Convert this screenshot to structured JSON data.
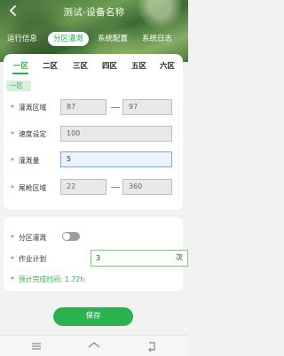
{
  "header": {
    "title": "测试-设备名称"
  },
  "tabs": [
    {
      "label": "运行信息"
    },
    {
      "label": "分区灌溉"
    },
    {
      "label": "系统配置"
    },
    {
      "label": "系统日志"
    }
  ],
  "zones": {
    "items": [
      "一区",
      "二区",
      "三区",
      "四区",
      "五区",
      "六区"
    ],
    "selected_label": "一区"
  },
  "form": {
    "irrigation_area": {
      "label": "灌溉区域",
      "from": "87",
      "to": "97"
    },
    "speed": {
      "label": "速度设定",
      "value": "100"
    },
    "irrigation_amount": {
      "label": "灌溉量",
      "value": "5"
    },
    "tail_gun_area": {
      "label": "尾枪区域",
      "from": "22",
      "to": "360"
    }
  },
  "zone_irrigation": {
    "label": "分区灌溉",
    "enabled": false
  },
  "work_plan": {
    "label": "作业计划",
    "value": "3",
    "unit": "次"
  },
  "estimate": {
    "label": "预计完成时间: 1.72h"
  },
  "save_label": "保存",
  "colors": {
    "accent": "#2bb24c",
    "required": "#e23a3a"
  }
}
